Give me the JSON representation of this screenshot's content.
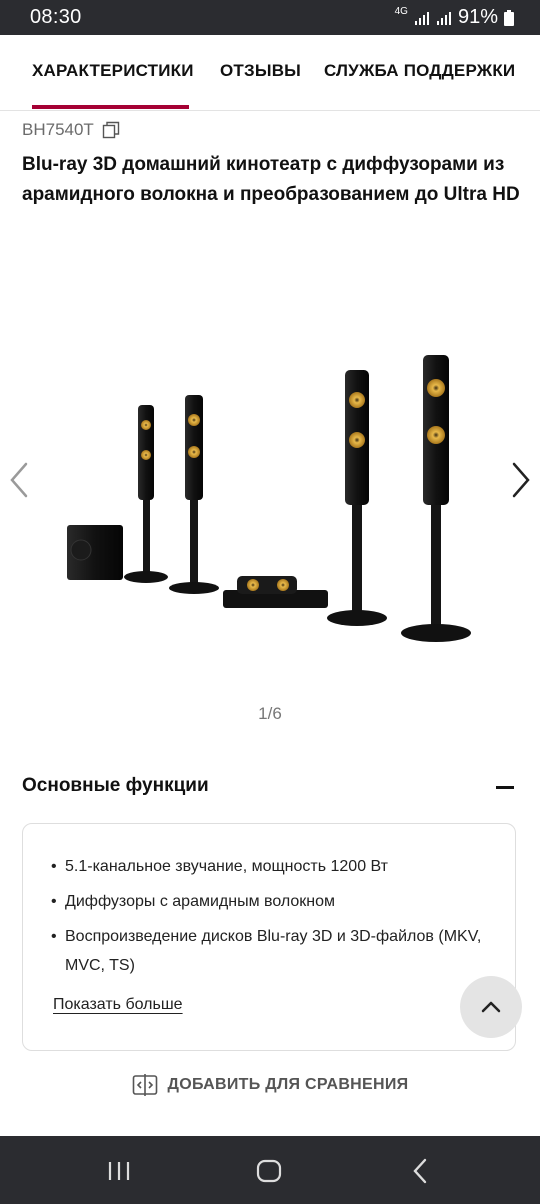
{
  "status_bar": {
    "time": "08:30",
    "network": "4G",
    "battery": "91%"
  },
  "tabs": [
    {
      "label": "ХАРАКТЕРИСТИКИ",
      "active": true
    },
    {
      "label": "ОТЗЫВЫ",
      "active": false
    },
    {
      "label": "СЛУЖБА ПОДДЕРЖКИ",
      "active": false
    }
  ],
  "product": {
    "model": "BH7540T",
    "title": "Blu-ray 3D домашний кинотеатр с диффузорами из арамидного волокна и преобразованием до Ultra HD"
  },
  "carousel": {
    "indicator": "1/6",
    "current": 1,
    "total": 6
  },
  "features": {
    "title": "Основные функции",
    "items": [
      "5.1-канальное звучание, мощность 1200 Вт",
      "Диффузоры с арамидным волокном",
      "Воспроизведение дисков Blu-ray 3D и 3D-файлов (MKV, MVC, TS)"
    ],
    "show_more": "Показать больше"
  },
  "compare": {
    "label": "ДОБАВИТЬ ДЛЯ СРАВНЕНИЯ"
  },
  "colors": {
    "accent": "#a50034",
    "status_bar": "#2b2c30",
    "speaker_cone": "#d4a33a"
  },
  "icons": [
    "copy-icon",
    "chevron-left-icon",
    "chevron-right-icon",
    "minus-icon",
    "chevron-up-icon",
    "compare-icon",
    "recent-apps-icon",
    "home-icon",
    "back-icon"
  ]
}
